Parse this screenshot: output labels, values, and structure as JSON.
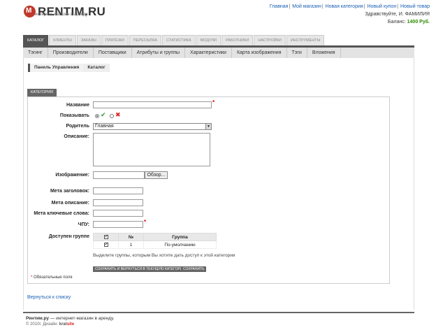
{
  "header": {
    "logo_text": "RENTIM.RU",
    "logo_tagline": "интернет-магазин в аренду",
    "top_links": [
      "Главная",
      "Мой магазин",
      "Новая категория",
      "Новый купон",
      "Новый товар"
    ],
    "greeting": "Здравствуйте, И. ФАМИЛИЯ",
    "balance_label": "Баланс:",
    "balance_value": "1400 Руб.",
    "colors": {
      "accent_red": "#c0392b",
      "balance_green": "#2e8b00"
    }
  },
  "main_tabs": [
    "КАТАЛОГ",
    "КЛИЕНТЫ",
    "ЗАКАЗЫ",
    "ПЛАТЕЖИ",
    "ПЕРЕСЫЛКА",
    "СТАТИСТИКА",
    "МОДУЛИ",
    "РАБОТНИКИ",
    "НАСТРОЙКИ",
    "ИНСТРУМЕНТЫ"
  ],
  "active_main_tab": "КАТАЛОГ",
  "sub_nav": [
    "Тэгинг",
    "Производители",
    "Поставщики",
    "Атрибуты и группы",
    "Характеристики",
    "Карта изображения",
    "Тэги",
    "Вложения"
  ],
  "breadcrumb": [
    "Панель Управления",
    "Каталог"
  ],
  "form": {
    "tab_label": "КАТЕГОРИЯ",
    "name_label": "Название",
    "show_label": "Показывать",
    "parent_label": "Родитель",
    "parent_value": "Главная",
    "description_label": "Описание:",
    "image_label": "Изображение:",
    "browse_label": "Обзор...",
    "meta_title_label": "Мета заголовок:",
    "meta_description_label": "Мета описание:",
    "meta_keywords_label": "Мета ключевые слова:",
    "chpu_label": "ЧПУ:",
    "access_label": "Доступен группе",
    "table_headers": [
      "",
      "№",
      "Группа"
    ],
    "table_rows": [
      {
        "num": "1",
        "group": "По-умолчанию"
      }
    ],
    "group_hint": "Выделите группы, которым Вы хотите дать доступ к этой категории",
    "save_return_label": "СОХРАНИТЬ И ВЕРНУТЬСЯ В ТЕКУЩУЮ КАТЕГОРИЮ",
    "save_label": "СОХРАНИТЬ",
    "required_note": "Обязательные поля",
    "required_star": "*"
  },
  "back_link": "Вернуться к списку",
  "footer": {
    "line1_brand": "Рентим.ру",
    "line1_rest": " — интернет-магазин в аренду.",
    "line2_prefix": "© 2010г. Дизайн:",
    "designer_part1": "krat",
    "designer_part2": "site"
  }
}
